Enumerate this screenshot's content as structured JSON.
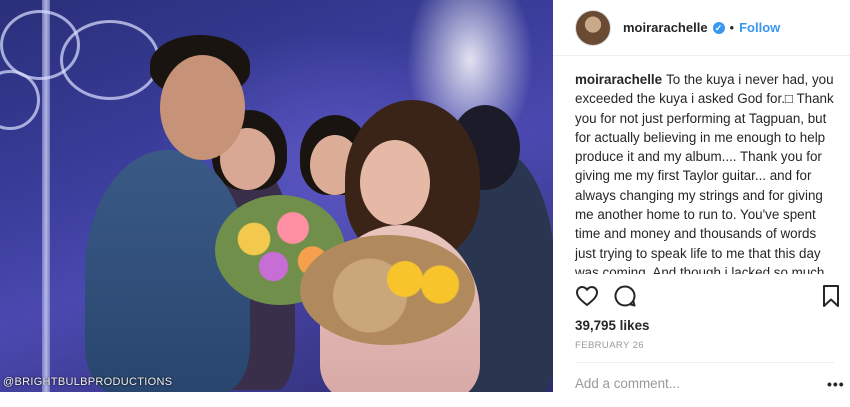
{
  "photo": {
    "watermark": "@BRIGHTBULBPRODUCTIONS"
  },
  "header": {
    "username": "moirarachelle",
    "separator": "•",
    "follow_label": "Follow"
  },
  "caption": {
    "username": "moirarachelle",
    "text": "To the kuya i never had, you exceeded the kuya i asked God for.□ Thank you for not just performing at Tagpuan, but for actually believing in me enough to help produce it and my album.... Thank you for giving me my first Taylor guitar... and for always changing my strings and for giving me another home to run to. You've spent time and money and thousands of words just trying to speak life to me that this day was coming. And though i lacked so much faith, you never stopped anyway...... and"
  },
  "actions": {
    "icons": [
      "heart-icon",
      "comment-icon",
      "bookmark-icon"
    ]
  },
  "likes": "39,795 likes",
  "date": "FEBRUARY 26",
  "comment_input": {
    "placeholder": "Add a comment..."
  },
  "more_label": "•••",
  "colors": {
    "accent": "#3897f0",
    "text": "#262626",
    "muted": "#999999"
  }
}
